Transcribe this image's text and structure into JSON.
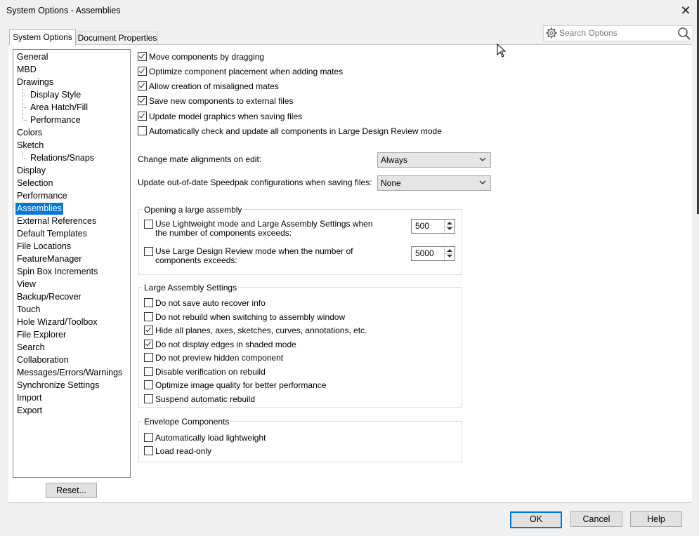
{
  "window": {
    "title": "System Options - Assemblies",
    "close_glyph": "✕"
  },
  "tabs": [
    {
      "label": "System Options",
      "active": true
    },
    {
      "label": "Document Properties",
      "active": false
    }
  ],
  "search": {
    "placeholder": "Search Options",
    "icons": [
      "gear-icon",
      "magnifier-icon"
    ]
  },
  "nav": {
    "items": [
      {
        "label": "General",
        "indent": 0,
        "selected": false
      },
      {
        "label": "MBD",
        "indent": 0,
        "selected": false
      },
      {
        "label": "Drawings",
        "indent": 0,
        "selected": false
      },
      {
        "label": "Display Style",
        "indent": 1,
        "selected": false
      },
      {
        "label": "Area Hatch/Fill",
        "indent": 1,
        "selected": false
      },
      {
        "label": "Performance",
        "indent": 1,
        "selected": false
      },
      {
        "label": "Colors",
        "indent": 0,
        "selected": false
      },
      {
        "label": "Sketch",
        "indent": 0,
        "selected": false
      },
      {
        "label": "Relations/Snaps",
        "indent": 1,
        "selected": false
      },
      {
        "label": "Display",
        "indent": 0,
        "selected": false
      },
      {
        "label": "Selection",
        "indent": 0,
        "selected": false
      },
      {
        "label": "Performance",
        "indent": 0,
        "selected": false
      },
      {
        "label": "Assemblies",
        "indent": 0,
        "selected": true
      },
      {
        "label": "External References",
        "indent": 0,
        "selected": false
      },
      {
        "label": "Default Templates",
        "indent": 0,
        "selected": false
      },
      {
        "label": "File Locations",
        "indent": 0,
        "selected": false
      },
      {
        "label": "FeatureManager",
        "indent": 0,
        "selected": false
      },
      {
        "label": "Spin Box Increments",
        "indent": 0,
        "selected": false
      },
      {
        "label": "View",
        "indent": 0,
        "selected": false
      },
      {
        "label": "Backup/Recover",
        "indent": 0,
        "selected": false
      },
      {
        "label": "Touch",
        "indent": 0,
        "selected": false
      },
      {
        "label": "Hole Wizard/Toolbox",
        "indent": 0,
        "selected": false
      },
      {
        "label": "File Explorer",
        "indent": 0,
        "selected": false
      },
      {
        "label": "Search",
        "indent": 0,
        "selected": false
      },
      {
        "label": "Collaboration",
        "indent": 0,
        "selected": false
      },
      {
        "label": "Messages/Errors/Warnings",
        "indent": 0,
        "selected": false
      },
      {
        "label": "Synchronize Settings",
        "indent": 0,
        "selected": false
      },
      {
        "label": "Import",
        "indent": 0,
        "selected": false
      },
      {
        "label": "Export",
        "indent": 0,
        "selected": false
      }
    ],
    "reset_label": "Reset...",
    "selected_color": "#0078d7"
  },
  "options": {
    "top_checkboxes": [
      {
        "label": "Move components by dragging",
        "checked": true
      },
      {
        "label": "Optimize component placement when adding mates",
        "checked": true
      },
      {
        "label": "Allow creation of misaligned mates",
        "checked": true
      },
      {
        "label": "Save new components to external files",
        "checked": true
      },
      {
        "label": "Update model graphics when saving files",
        "checked": true
      },
      {
        "label": "Automatically check and update all components in Large Design Review mode",
        "checked": false
      }
    ],
    "mate_alignment": {
      "label": "Change mate alignments on edit:",
      "value": "Always"
    },
    "speedpak": {
      "label": "Update out-of-date Speedpak configurations when saving files:",
      "value": "None"
    },
    "opening_group": {
      "title": "Opening a large assembly",
      "rows": [
        {
          "label_line1": "Use Lightweight mode and Large Assembly Settings when",
          "label_line2": "the number of components exceeds:",
          "checked": false,
          "value": "500"
        },
        {
          "label_line1": "Use Large Design Review mode when the number of",
          "label_line2": "components exceeds:",
          "checked": false,
          "value": "5000"
        }
      ]
    },
    "large_settings_group": {
      "title": "Large Assembly Settings",
      "checkboxes": [
        {
          "label": "Do not save auto recover info",
          "checked": false
        },
        {
          "label": "Do not rebuild when switching to assembly window",
          "checked": false
        },
        {
          "label": "Hide all planes, axes, sketches, curves, annotations, etc.",
          "checked": true
        },
        {
          "label": "Do not display edges in shaded mode",
          "checked": true
        },
        {
          "label": "Do not preview hidden component",
          "checked": false
        },
        {
          "label": "Disable verification on rebuild",
          "checked": false
        },
        {
          "label": "Optimize image quality for better performance",
          "checked": false
        },
        {
          "label": "Suspend automatic rebuild",
          "checked": false
        }
      ]
    },
    "envelope_group": {
      "title": "Envelope Components",
      "checkboxes": [
        {
          "label": "Automatically load lightweight",
          "checked": false
        },
        {
          "label": "Load read-only",
          "checked": false
        }
      ]
    }
  },
  "footer": {
    "ok": "OK",
    "cancel": "Cancel",
    "help": "Help"
  }
}
